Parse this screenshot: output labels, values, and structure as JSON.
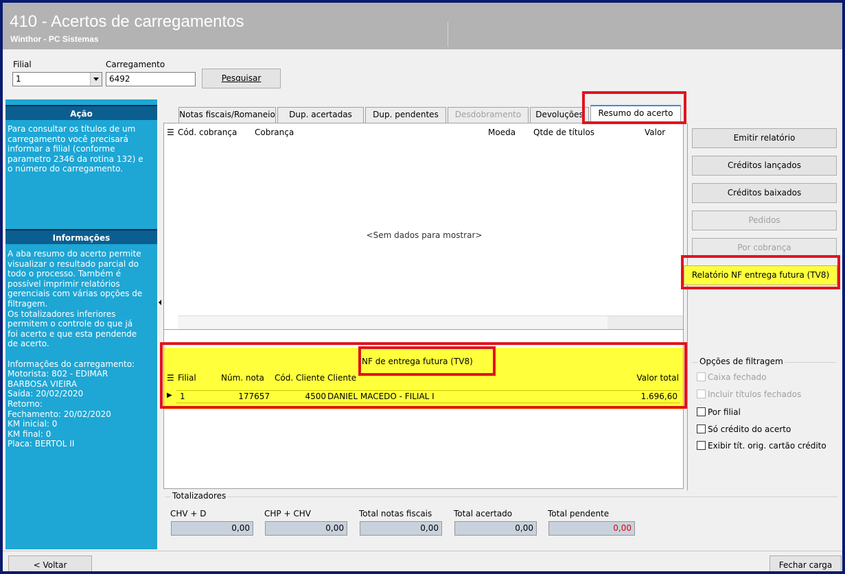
{
  "window": {
    "title": "410 - Acertos de carregamentos",
    "subtitle": "Winthor - PC Sistemas"
  },
  "filters": {
    "filial_label": "Filial",
    "filial_value": "1",
    "carregamento_label": "Carregamento",
    "carregamento_value": "6492",
    "search_button": "Pesquisar"
  },
  "left_panel": {
    "acao_title": "Ação",
    "acao_text": "Para consultar os títulos de um\ncarregamento você precisará\ninformar a filial (conforme\nparametro 2346 da rotina 132) e\no número do carregamento.",
    "info_title": "Informações",
    "info_text": "A aba resumo do acerto permite\nvisualizar o resultado parcial do\ntodo o processo. Também é\npossível imprimir relatórios\ngerenciais com várias opções de\nfiltragem.\nOs totalizadores inferiores\npermitem o controle do que já\nfoi acerto e que esta pendende\nde acerto.\n\nInformações do carregamento:\nMotorista: 802 - EDIMAR\nBARBOSA VIEIRA\nSaída: 20/02/2020\nRetorno:\nFechamento: 20/02/2020\nKM inicial: 0\nKM final: 0\nPlaca: BERTOL II"
  },
  "tabs": [
    {
      "label": "Notas fiscais/Romaneio"
    },
    {
      "label": "Dup. acertadas"
    },
    {
      "label": "Dup. pendentes"
    },
    {
      "label": "Desdobramento"
    },
    {
      "label": "Devoluções"
    },
    {
      "label": "Resumo do acerto"
    }
  ],
  "main_grid": {
    "columns": [
      "Cód. cobrança",
      "Cobrança",
      "Moeda",
      "Qtde de títulos",
      "Valor"
    ],
    "empty_text": "<Sem dados para mostrar>"
  },
  "tv8_grid": {
    "title": "NF de entrega futura (TV8)",
    "columns": [
      "Filial",
      "Núm. nota",
      "Cód. Cliente",
      "Cliente",
      "Valor total"
    ],
    "rows": [
      {
        "filial": "1",
        "num_nota": "177657",
        "cod_cliente": "4500",
        "cliente": "DANIEL MACEDO - FILIAL I",
        "valor_total": "1.696,60"
      }
    ]
  },
  "right_buttons": {
    "emitir": "Emitir relatório",
    "creditos_lancados": "Créditos lançados",
    "creditos_baixados": "Créditos baixados",
    "pedidos": "Pedidos",
    "por_cobranca": "Por cobrança",
    "relatorio_tv8": "Relatório NF entrega futura (TV8)"
  },
  "filter_options": {
    "title": "Opções de filtragem",
    "caixa_fechado": "Caixa fechado",
    "incluir_titulos": "Incluir títulos fechados",
    "por_filial": "Por filial",
    "so_credito": "Só crédito do acerto",
    "exibir_tit": "Exibir tít. orig. cartão crédito"
  },
  "totals": {
    "title": "Totalizadores",
    "chv_d_label": "CHV + D",
    "chv_d_value": "0,00",
    "chp_chv_label": "CHP + CHV",
    "chp_chv_value": "0,00",
    "total_nf_label": "Total notas fiscais",
    "total_nf_value": "0,00",
    "total_acertado_label": "Total acertado",
    "total_acertado_value": "0,00",
    "total_pendente_label": "Total pendente",
    "total_pendente_value": "0,00"
  },
  "bottom": {
    "voltar": "< Voltar",
    "fechar": "Fechar carga"
  },
  "colors": {
    "highlight_yellow": "#ffff3c",
    "annotation_red": "#e0141e",
    "panel_blue": "#1ea6d5",
    "panel_header": "#0b5e90",
    "negative_red": "#e00000"
  }
}
